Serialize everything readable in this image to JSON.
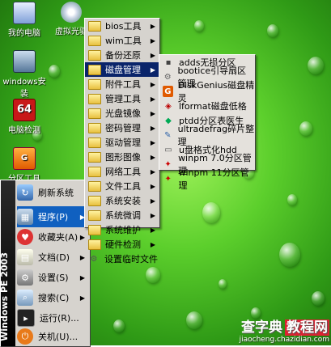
{
  "desktop": {
    "icons": [
      {
        "label": "我的电脑"
      },
      {
        "label": "虚拟光驱"
      },
      {
        "label": "windows安装"
      },
      {
        "label": "电脑检测"
      },
      {
        "label": "分区工具"
      }
    ],
    "pc_check_badge": "64"
  },
  "start_menu": {
    "sidebar_text": "Windows PE 2003",
    "items": [
      {
        "label": "刷新系统"
      },
      {
        "label": "程序(P)"
      },
      {
        "label": "收藏夹(A)"
      },
      {
        "label": "文档(D)"
      },
      {
        "label": "设置(S)"
      },
      {
        "label": "搜索(C)"
      },
      {
        "label": "运行(R)..."
      },
      {
        "label": "关机(U)..."
      }
    ]
  },
  "programs_menu": {
    "items": [
      {
        "label": "bios工具"
      },
      {
        "label": "wim工具"
      },
      {
        "label": "备份还原"
      },
      {
        "label": "磁盘管理"
      },
      {
        "label": "附件工具"
      },
      {
        "label": "管理工具"
      },
      {
        "label": "光盘镜像"
      },
      {
        "label": "密码管理"
      },
      {
        "label": "驱动管理"
      },
      {
        "label": "图形图像"
      },
      {
        "label": "网络工具"
      },
      {
        "label": "文件工具"
      },
      {
        "label": "系统安装"
      },
      {
        "label": "系统微调"
      },
      {
        "label": "系统维护"
      },
      {
        "label": "硬件检测"
      },
      {
        "label": "设置临时文件"
      }
    ]
  },
  "disk_menu": {
    "items": [
      {
        "label": "adds无损分区"
      },
      {
        "label": "bootice引导扇区管理"
      },
      {
        "label": "DiskGenius磁盘精灵"
      },
      {
        "label": "lformat磁盘低格"
      },
      {
        "label": "ptdd分区表医生"
      },
      {
        "label": "ultradefrag碎片整理"
      },
      {
        "label": "u盘格式化hdd"
      },
      {
        "label": "winpm 7.0分区管理"
      },
      {
        "label": "winpm 11分区管理"
      }
    ]
  },
  "watermark": {
    "site": "查字典",
    "tag": "教程网",
    "url": "jiaocheng.chazidian.com"
  },
  "colors": {
    "highlight": "#0a246a",
    "start_selected": "#1060c0"
  }
}
